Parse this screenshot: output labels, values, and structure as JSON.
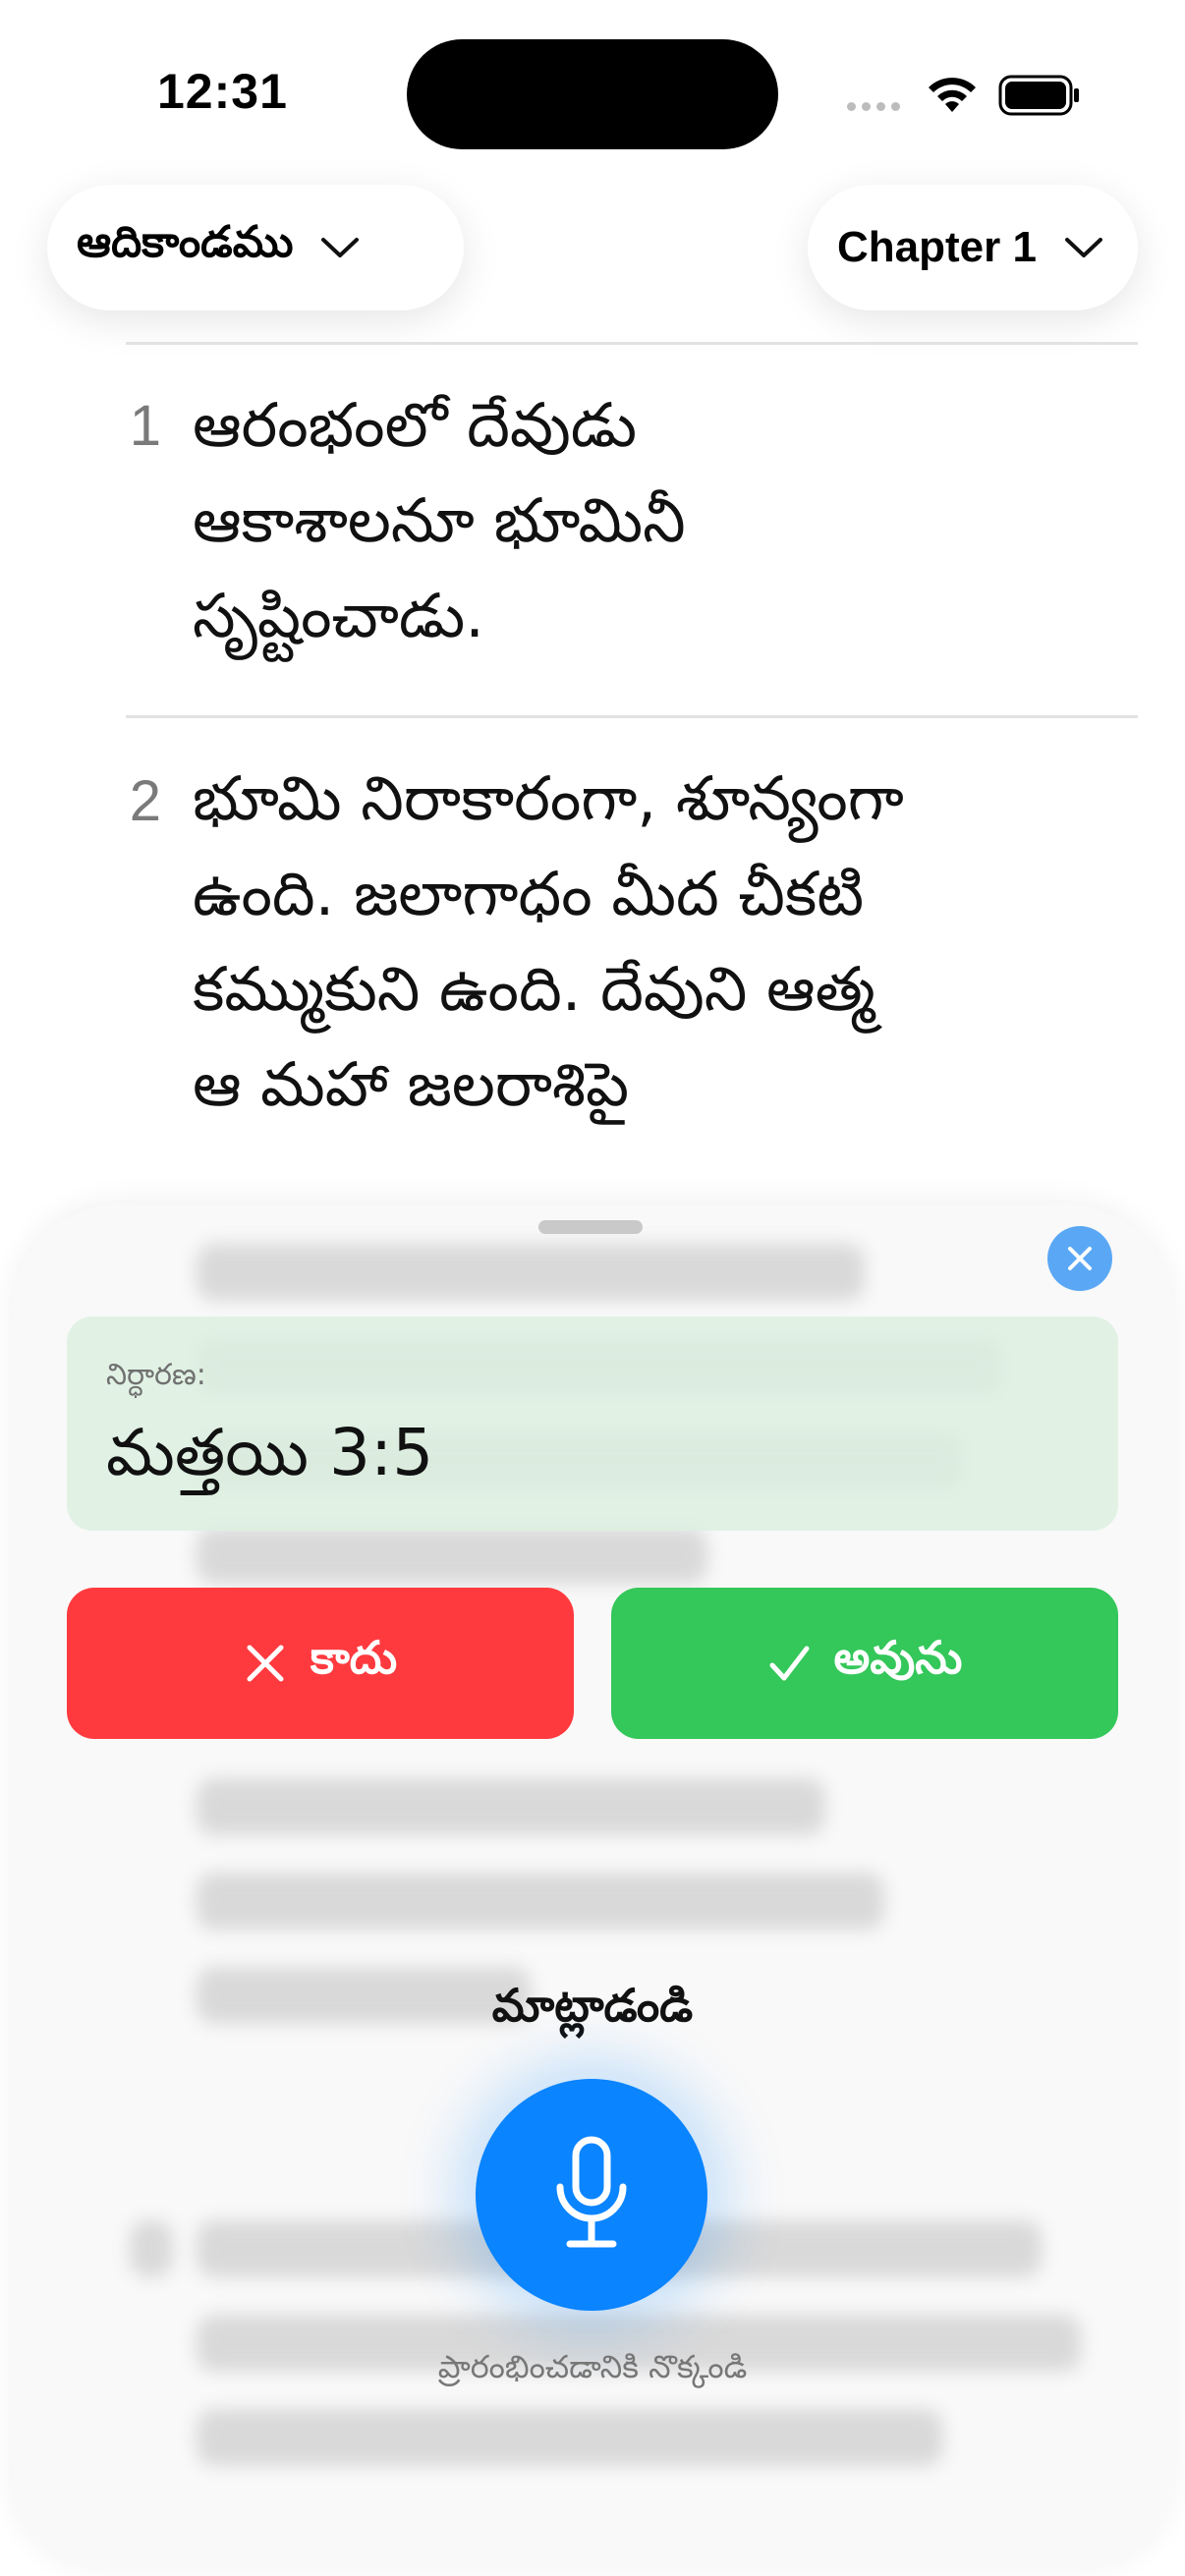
{
  "status_bar": {
    "time": "12:31"
  },
  "header": {
    "book_picker": {
      "label": "ఆదికాండము"
    },
    "chapter_picker": {
      "label": "Chapter 1"
    }
  },
  "verses": [
    {
      "number": "1",
      "lines": [
        "ఆరంభంలో దేవుడు",
        "ఆకాశాలనూ భూమినీ",
        "సృష్టించాడు."
      ]
    },
    {
      "number": "2",
      "lines": [
        "భూమి నిరాకారంగా, శూన్యంగా",
        "ఉంది. జలాగాధం మీద చీకటి",
        "కమ్ముకుని ఉంది. దేవుని ఆత్మ",
        "ఆ మహా జలరాశిపై"
      ]
    }
  ],
  "sheet": {
    "result": {
      "label": "నిర్ధారణ:",
      "value": "మత్తయి 3:5"
    },
    "reject_button": {
      "label": "కాదు",
      "color": "#fe3a3f"
    },
    "confirm_button": {
      "label": "అవును",
      "color": "#34c75a"
    },
    "speak_title": "మాట్లాడండి",
    "hint": "ప్రారంభించడానికి నొక్కండి",
    "mic_color": "#0a84ff"
  }
}
